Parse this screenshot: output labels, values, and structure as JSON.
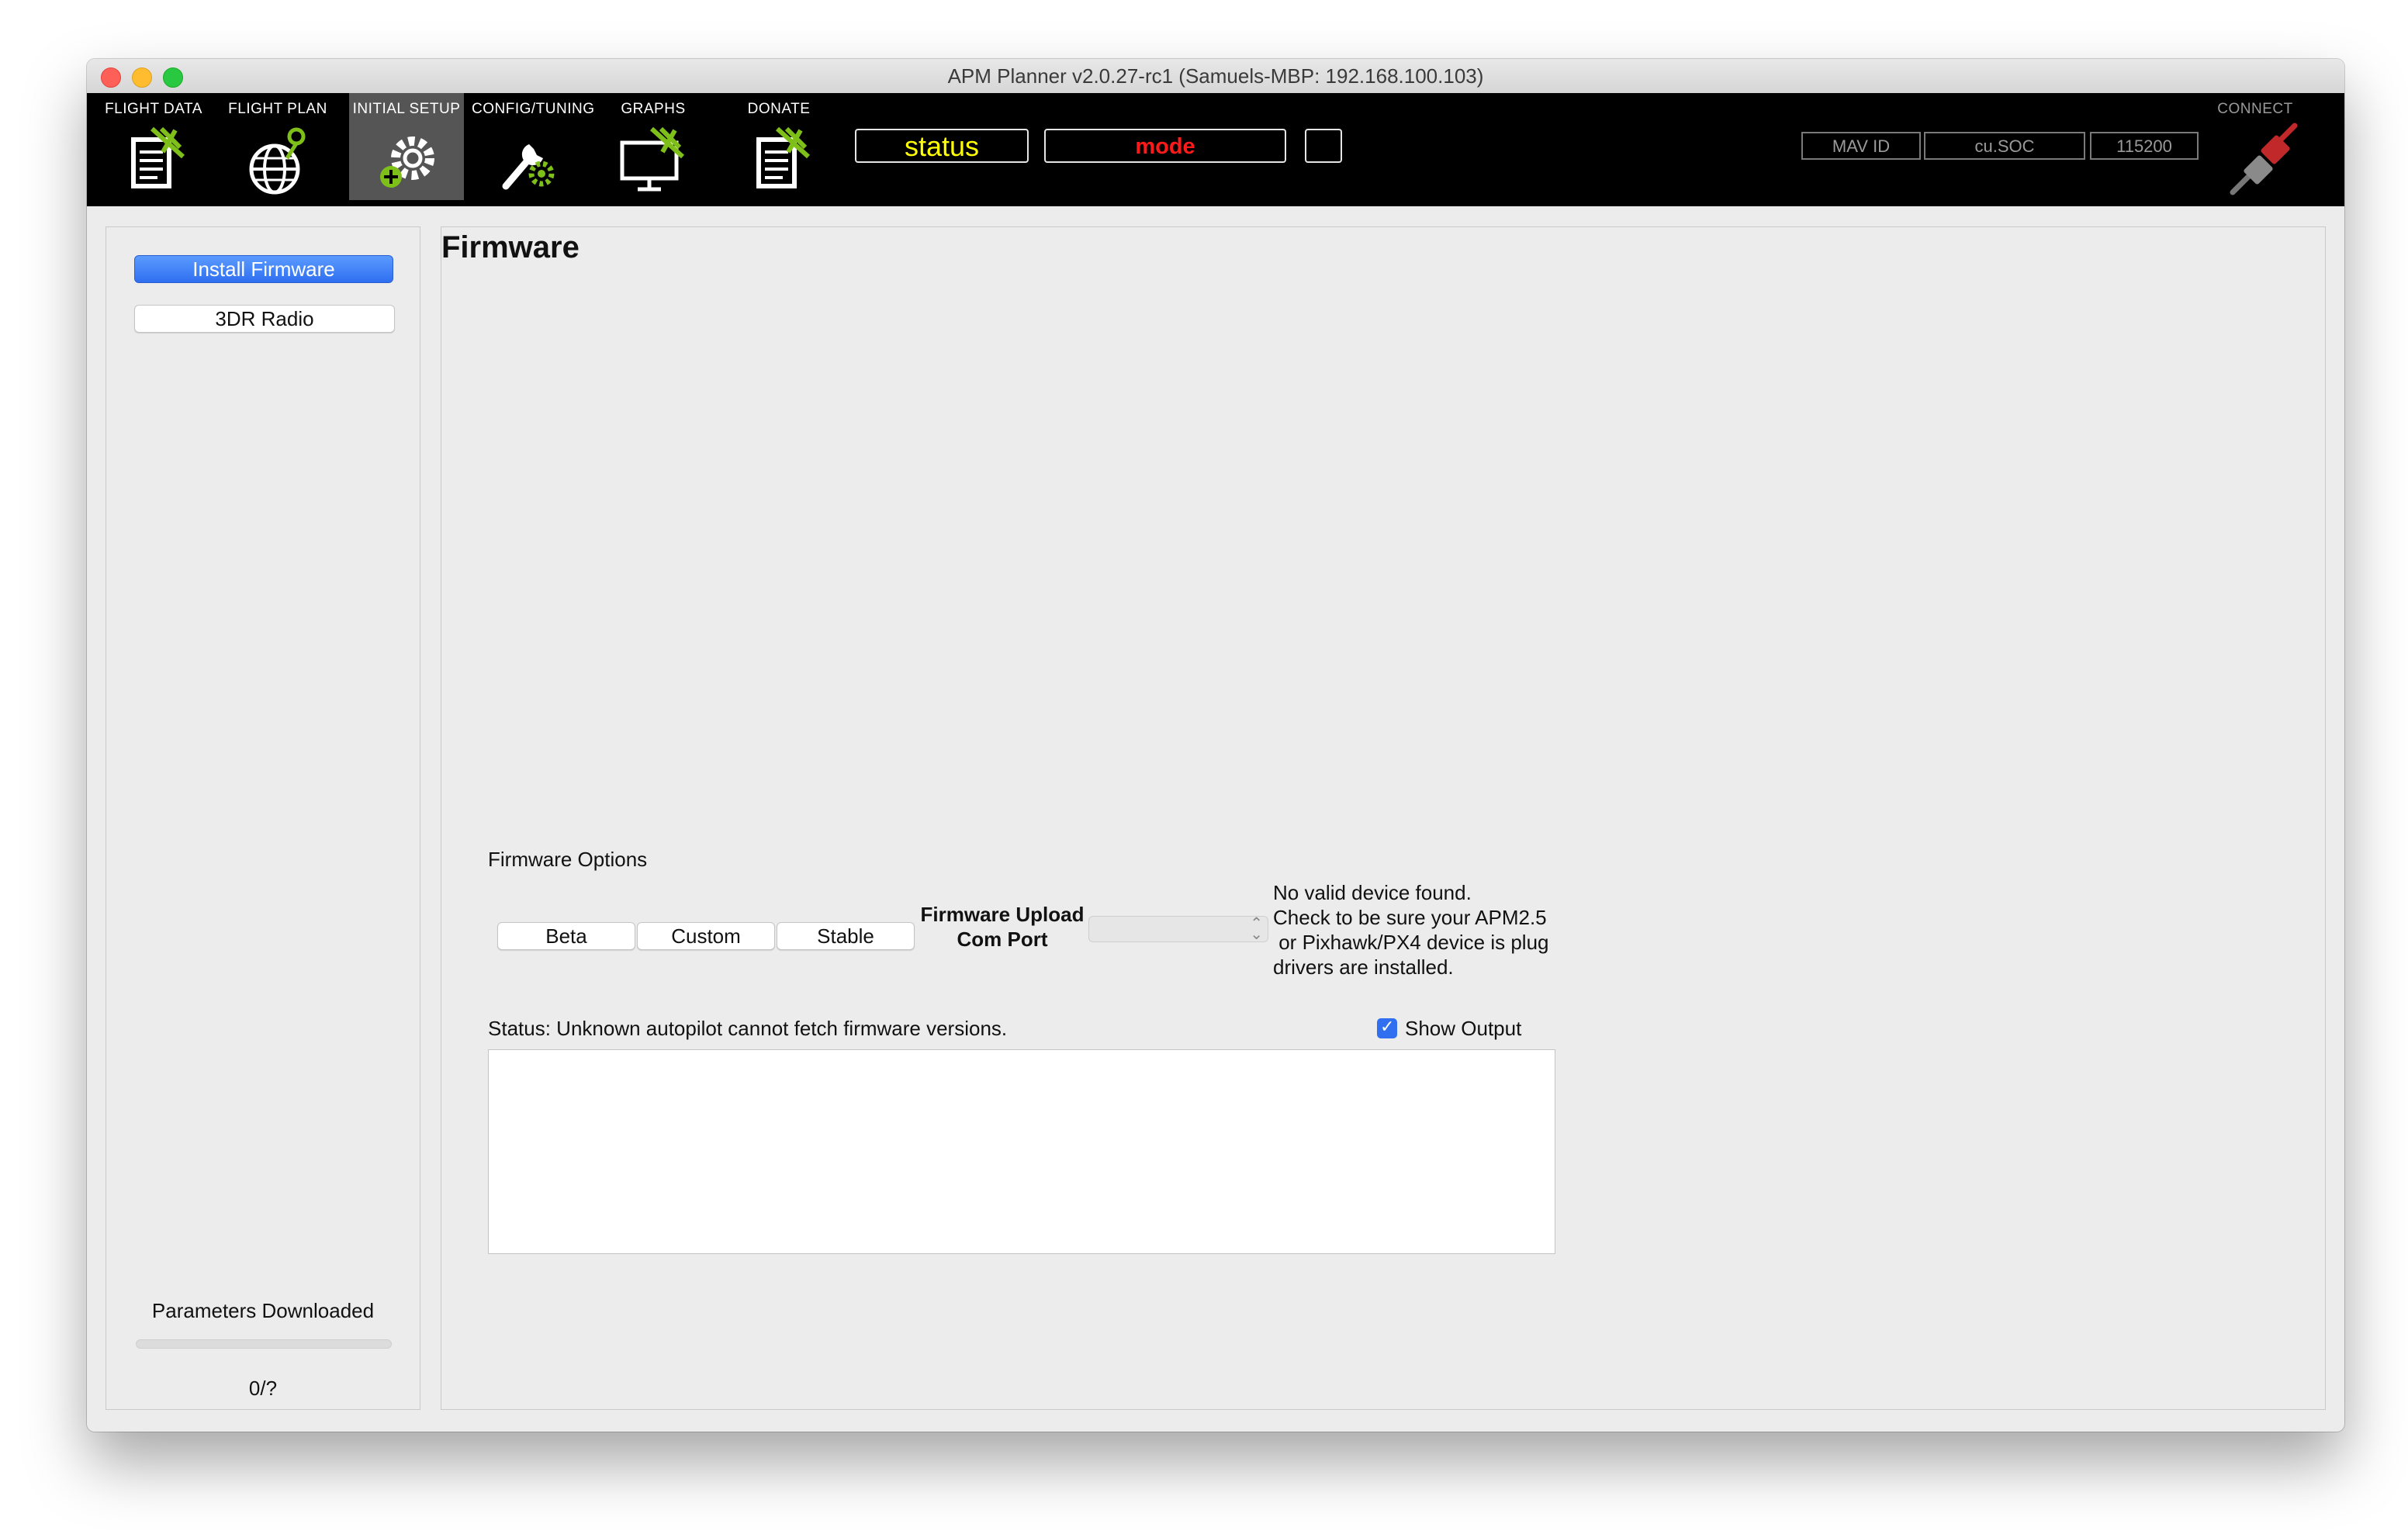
{
  "window": {
    "title": "APM Planner v2.0.27-rc1 (Samuels-MBP: 192.168.100.103)"
  },
  "toolbar": {
    "tabs": [
      {
        "label": "FLIGHT DATA",
        "icon": "flight-data-icon"
      },
      {
        "label": "FLIGHT PLAN",
        "icon": "flight-plan-icon"
      },
      {
        "label": "INITIAL SETUP",
        "icon": "initial-setup-icon"
      },
      {
        "label": "CONFIG/TUNING",
        "icon": "config-tuning-icon"
      },
      {
        "label": "GRAPHS",
        "icon": "graphs-icon"
      },
      {
        "label": "DONATE",
        "icon": "donate-icon"
      }
    ],
    "status_text": "status",
    "mode_text": "mode",
    "mav_id": "MAV ID",
    "port": "cu.SOC",
    "baud": "115200",
    "connect_label": "CONNECT",
    "colors": {
      "status": "#ffff00",
      "mode": "#ff1a1a",
      "active_tab": "#555555"
    }
  },
  "sidebar": {
    "install_firmware": "Install Firmware",
    "radio": "3DR Radio",
    "params_label": "Parameters Downloaded",
    "params_progress": 0,
    "params_count": "0/?"
  },
  "main": {
    "title": "Firmware",
    "options_label": "Firmware Options",
    "buttons": {
      "beta": "Beta",
      "custom": "Custom",
      "stable": "Stable"
    },
    "upload_label_1": "Firmware Upload",
    "upload_label_2": "Com Port",
    "device_msg": [
      "No valid device found.",
      "Check to be sure your APM2.5",
      " or Pixhawk/PX4 device is plug",
      "drivers are installed."
    ],
    "status_prefix": "Status:",
    "status_text": "Unknown autopilot cannot fetch firmware versions.",
    "show_output": "Show Output",
    "show_output_checked": true
  }
}
